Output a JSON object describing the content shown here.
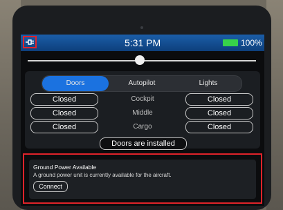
{
  "status": {
    "time": "5:31 PM",
    "battery": "100%",
    "battery_level": 1.0
  },
  "brightness": {
    "level": 0.49
  },
  "tabs": [
    "Doors",
    "Autopilot",
    "Lights"
  ],
  "active_tab": "Doors",
  "doors": [
    {
      "location": "Cockpit",
      "left": "Closed",
      "right": "Closed"
    },
    {
      "location": "Middle",
      "left": "Closed",
      "right": "Closed"
    },
    {
      "location": "Cargo",
      "left": "Closed",
      "right": "Closed"
    }
  ],
  "doors_status": "Doors are installed",
  "notification": {
    "title": "Ground Power Available",
    "body": "A ground power unit is currently available for the aircraft.",
    "button": "Connect"
  },
  "colors": {
    "accent": "#1b72e0",
    "highlight": "#e0232a",
    "battery": "#37d34a"
  },
  "icons": {
    "status_left": "plug-icon"
  }
}
